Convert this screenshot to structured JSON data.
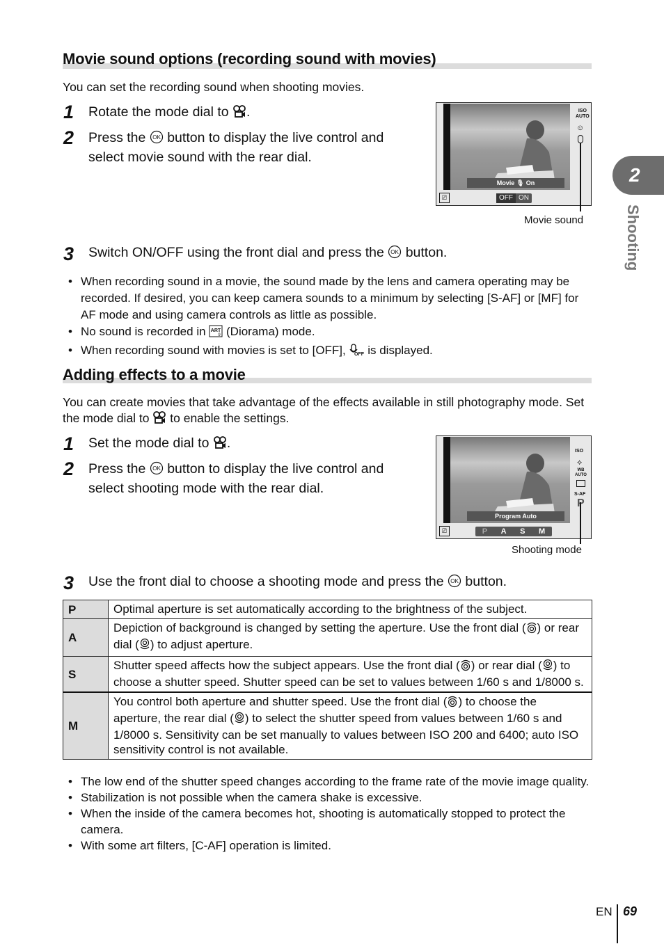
{
  "section1": {
    "title": "Movie sound options (recording sound with movies)",
    "intro": "You can set the recording sound when shooting movies.",
    "steps": [
      {
        "num": "1",
        "text_before": "Rotate the mode dial to ",
        "text_after": "."
      },
      {
        "num": "2",
        "text_before": "Press the ",
        "text_after": " button to display the live control and select movie sound with the rear dial."
      },
      {
        "num": "3",
        "text_before": "Switch ON/OFF using the front dial and press the ",
        "text_after": " button."
      }
    ],
    "screen": {
      "overlay_label": "Movie",
      "overlay_value": "On",
      "options": [
        "OFF",
        "ON"
      ],
      "callout": "Movie sound"
    },
    "notes": [
      "When recording sound in a movie, the sound made by the lens and camera operating may be recorded. If desired, you can keep camera sounds to a minimum by selecting [S-AF] or [MF] for AF mode and using camera controls as little as possible.",
      {
        "before": "No sound is recorded in ",
        "after": " (Diorama) mode."
      },
      {
        "before": "When recording sound with movies is set to [OFF], ",
        "after": " is displayed."
      }
    ]
  },
  "section2": {
    "title": "Adding effects to a movie",
    "intro_before": "You can create movies that take advantage of the effects available in still photography mode. Set the mode dial to ",
    "intro_after": " to enable the settings.",
    "steps": [
      {
        "num": "1",
        "text_before": "Set the mode dial to ",
        "text_after": "."
      },
      {
        "num": "2",
        "text_before": "Press the ",
        "text_after": " button to display the live control and select shooting mode with the rear dial."
      },
      {
        "num": "3",
        "text_before": "Use the front dial to choose a shooting mode and press the ",
        "text_after": " button."
      }
    ],
    "screen": {
      "overlay_label": "Program Auto",
      "options": [
        "P",
        "A",
        "S",
        "M"
      ],
      "callout": "Shooting mode"
    },
    "table": [
      {
        "key": "P",
        "parts": [
          "Optimal aperture is set automatically according to the brightness of the subject."
        ]
      },
      {
        "key": "A",
        "parts": [
          "Depiction of background is changed by setting the aperture. Use the front dial (",
          "front",
          ") or rear dial (",
          "rear",
          ") to adjust aperture."
        ]
      },
      {
        "key": "S",
        "parts": [
          "Shutter speed affects how the subject appears. Use the front dial (",
          "front",
          ") or rear dial (",
          "rear",
          ") to choose a shutter speed. Shutter speed can be set to values between 1/60 s and 1/8000 s."
        ]
      },
      {
        "key": "M",
        "parts": [
          "You control both aperture and shutter speed. Use the front dial (",
          "front",
          ") to choose the aperture, the rear dial (",
          "rear",
          ") to select the shutter speed from values between 1/60 s and 1/8000 s. Sensitivity can be set manually to values between ISO 200 and 6400; auto ISO sensitivity control is not available."
        ]
      }
    ],
    "notes": [
      "The low end of the shutter speed changes according to the frame rate of the movie image quality.",
      "Stabilization is not possible when the camera shake is excessive.",
      "When the inside of the camera becomes hot, shooting is automatically stopped to protect the camera.",
      "With some art filters, [C-AF] operation is limited."
    ]
  },
  "side_tab": {
    "chapter": "2",
    "label": "Shooting"
  },
  "footer": {
    "lang": "EN",
    "page": "69"
  }
}
